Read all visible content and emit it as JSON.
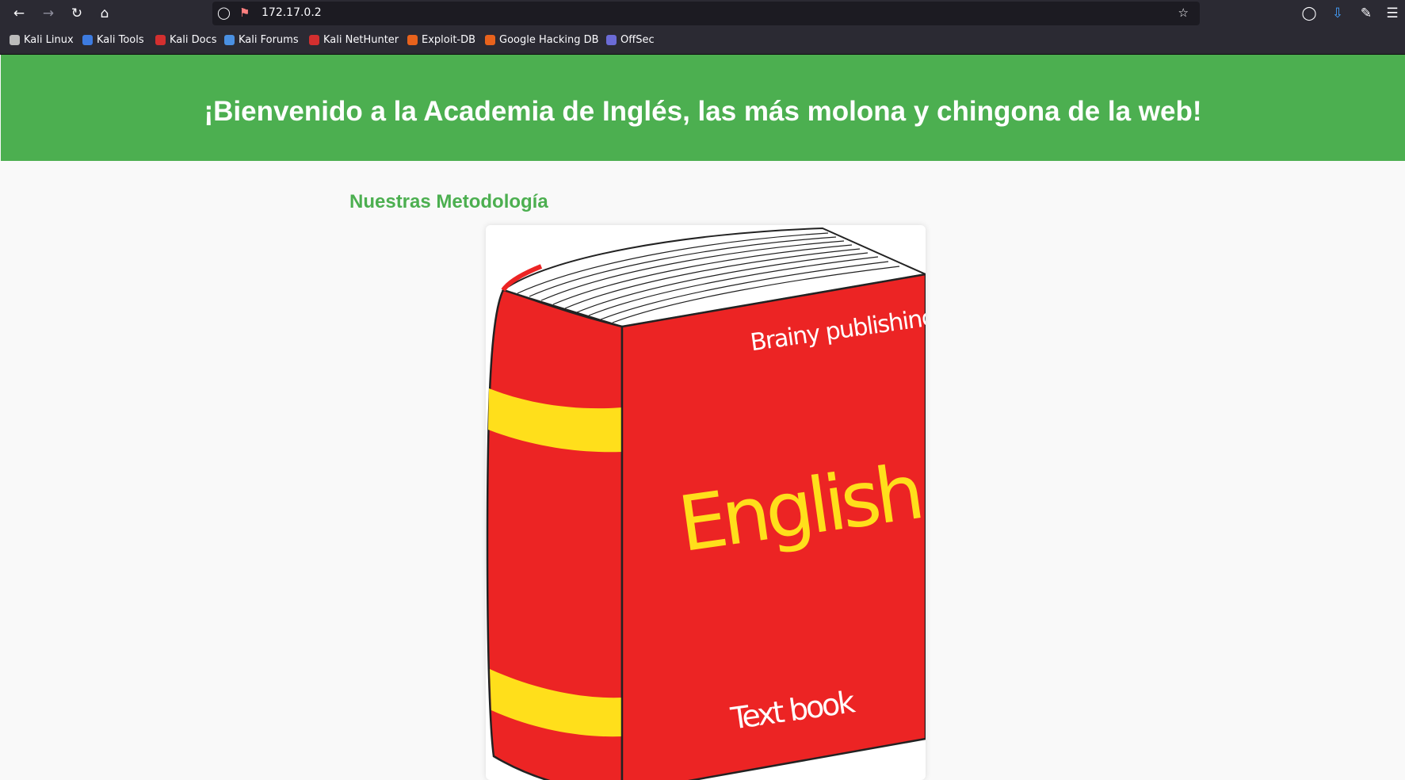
{
  "browser": {
    "url": "172.17.0.2",
    "bookmarks": [
      {
        "label": "Kali Linux",
        "color": "#e0e0e0"
      },
      {
        "label": "Kali Tools",
        "color": "#3d7be0"
      },
      {
        "label": "Kali Docs",
        "color": "#d32f2f"
      },
      {
        "label": "Kali Forums",
        "color": "#4a90e2"
      },
      {
        "label": "Kali NetHunter",
        "color": "#d32f2f"
      },
      {
        "label": "Exploit-DB",
        "color": "#e8621c"
      },
      {
        "label": "Google Hacking DB",
        "color": "#e8621c"
      },
      {
        "label": "OffSec",
        "color": "#6b6bd6"
      }
    ]
  },
  "page": {
    "header_title": "¡Bienvenido a la Academia de Inglés, las más molona y chingona de la web!",
    "section_title": "Nuestras Metodología",
    "book": {
      "publisher": "Brainy publishing",
      "title": "English",
      "subtitle": "Text book"
    }
  },
  "colors": {
    "accent": "#4caf50",
    "book_red": "#ec2424",
    "book_yellow": "#ffdf1b"
  }
}
